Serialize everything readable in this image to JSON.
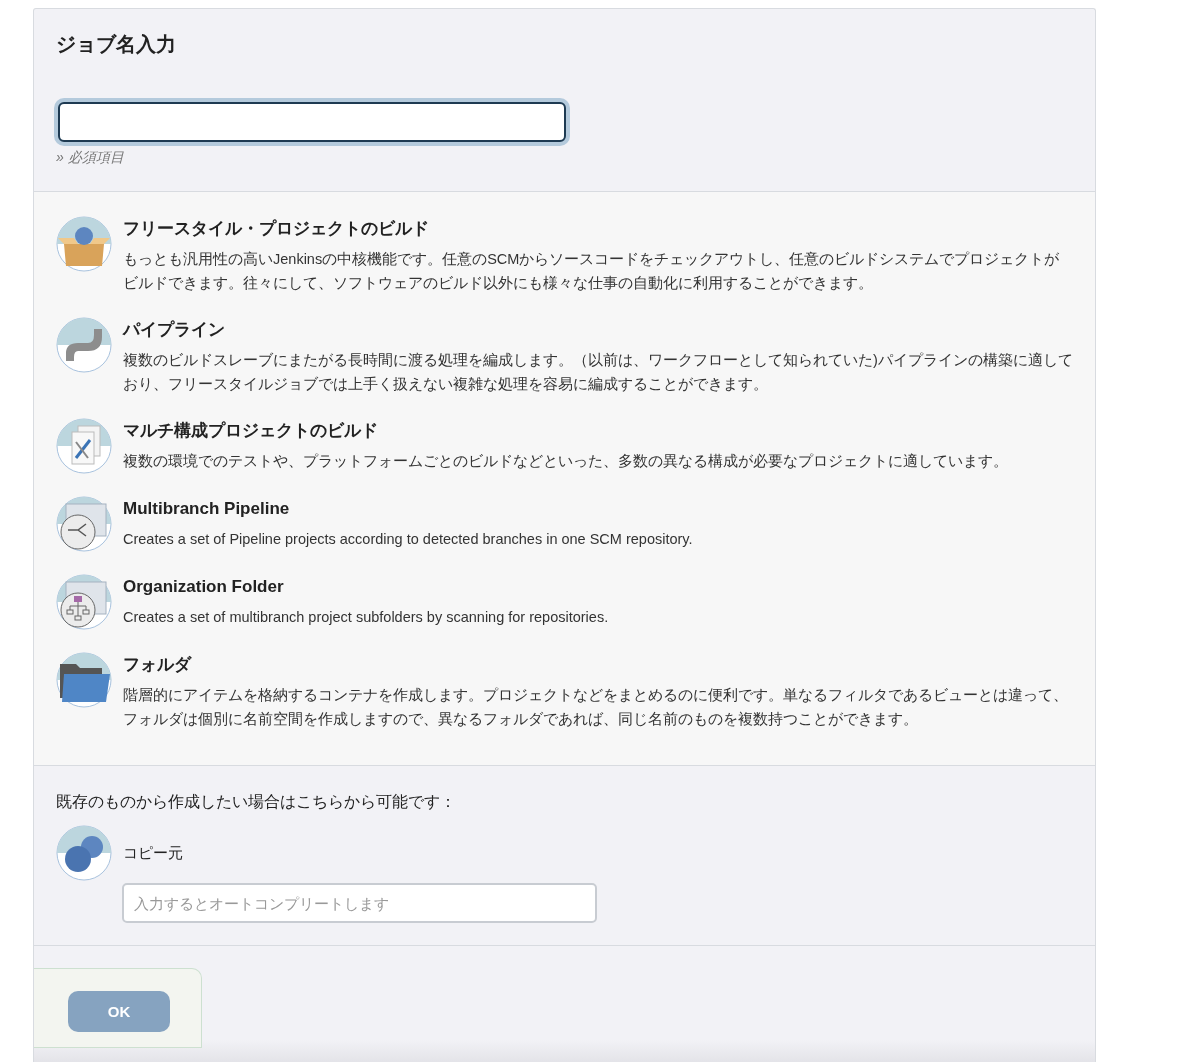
{
  "name_section": {
    "title": "ジョブ名入力",
    "hint": "» 必須項目"
  },
  "item_types": [
    {
      "kind": "freestyle",
      "title": "フリースタイル・プロジェクトのビルド",
      "description": "もっとも汎用性の高いJenkinsの中核機能です。任意のSCMからソースコードをチェックアウトし、任意のビルドシステムでプロジェクトがビルドできます。往々にして、ソフトウェアのビルド以外にも様々な仕事の自動化に利用することができます。"
    },
    {
      "kind": "pipeline",
      "title": "パイプライン",
      "description": "複数のビルドスレーブにまたがる長時間に渡る処理を編成します。（以前は、ワークフローとして知られていた)パイプラインの構築に適しており、フリースタイルジョブでは上手く扱えない複雑な処理を容易に編成することができます。"
    },
    {
      "kind": "matrix",
      "title": "マルチ構成プロジェクトのビルド",
      "description": "複数の環境でのテストや、プラットフォームごとのビルドなどといった、多数の異なる構成が必要なプロジェクトに適しています。"
    },
    {
      "kind": "multibranch",
      "title": "Multibranch Pipeline",
      "description": "Creates a set of Pipeline projects according to detected branches in one SCM repository."
    },
    {
      "kind": "organization",
      "title": "Organization Folder",
      "description": "Creates a set of multibranch project subfolders by scanning for repositories."
    },
    {
      "kind": "folder",
      "title": "フォルダ",
      "description": "階層的にアイテムを格納するコンテナを作成します。プロジェクトなどをまとめるのに便利です。単なるフィルタであるビューとは違って、フォルダは個別に名前空間を作成しますので、異なるフォルダであれば、同じ名前のものを複数持つことができます。"
    }
  ],
  "copy_section": {
    "intro": "既存のものから作成したい場合はこちらから可能です：",
    "label": "コピー元",
    "placeholder": "入力するとオートコンプリートします"
  },
  "ok_button": {
    "label": "OK",
    "disabled": true
  }
}
